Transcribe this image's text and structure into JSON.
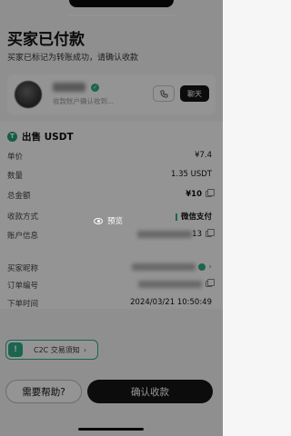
{
  "header": {
    "title": "买家已付款",
    "subtitle": "买家已标记为转账成功，请确认收款"
  },
  "merchant": {
    "note": "收款账户确认收到...",
    "chat_label": "聊天"
  },
  "order": {
    "title": "出售 USDT",
    "rows": [
      {
        "label": "单价",
        "value": "¥7.4"
      },
      {
        "label": "数量",
        "value": "1.35 USDT"
      },
      {
        "label": "总金额",
        "value": "¥10"
      },
      {
        "label": "收款方式",
        "value": "微信支付"
      },
      {
        "label": "账户信息",
        "value": "13"
      },
      {
        "label": "买家昵称",
        "value": ""
      },
      {
        "label": "订单编号",
        "value": ""
      },
      {
        "label": "下单时间",
        "value": "2024/03/21 10:50:49"
      }
    ]
  },
  "preview_label": "预览",
  "notice": {
    "label": "C2C 交易须知",
    "chevron": "›"
  },
  "footer": {
    "help_label": "需要帮助?",
    "confirm_label": "确认收款"
  },
  "icons": {
    "coin": "usdt-coin-icon",
    "verified": "verified-badge-icon",
    "call": "phone-icon",
    "copy": "copy-icon",
    "eye": "eye-icon",
    "notice": "c2c-notice-icon"
  },
  "colors": {
    "accent_green": "#2fae8a",
    "dark_button": "#151515",
    "overlay": "rgba(0,0,0,0.42)"
  }
}
